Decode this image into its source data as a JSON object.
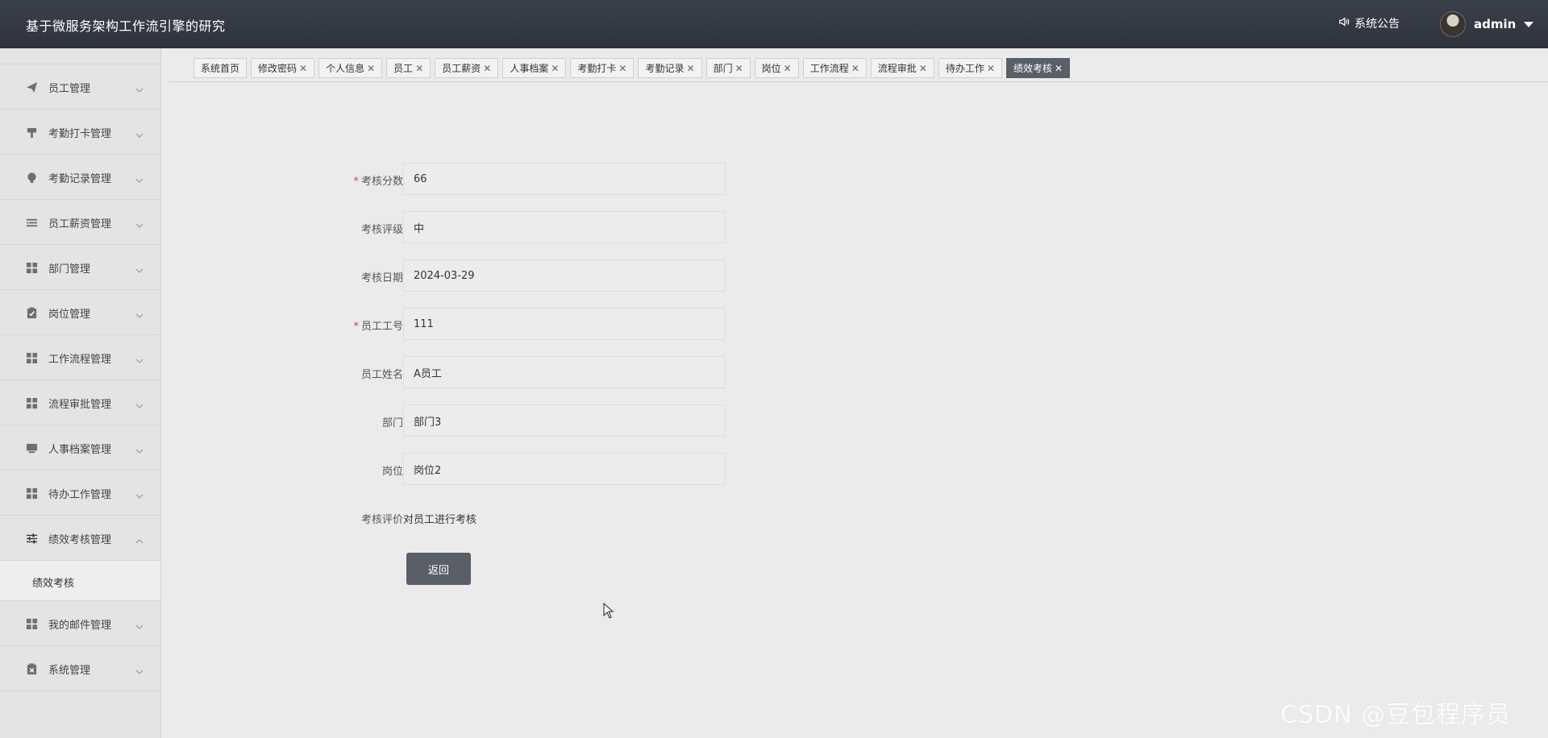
{
  "header": {
    "title": "基于微服务架构工作流引擎的研究",
    "notice_label": "系统公告",
    "username": "admin"
  },
  "sidebar": {
    "items": [
      {
        "label": "员工管理",
        "icon": "paper-plane-icon"
      },
      {
        "label": "考勤打卡管理",
        "icon": "brush-icon"
      },
      {
        "label": "考勤记录管理",
        "icon": "bulb-icon"
      },
      {
        "label": "员工薪资管理",
        "icon": "list-icon"
      },
      {
        "label": "部门管理",
        "icon": "grid-icon"
      },
      {
        "label": "岗位管理",
        "icon": "clipboard-check-icon"
      },
      {
        "label": "工作流程管理",
        "icon": "grid-icon"
      },
      {
        "label": "流程审批管理",
        "icon": "grid-icon"
      },
      {
        "label": "人事档案管理",
        "icon": "monitor-icon"
      },
      {
        "label": "待办工作管理",
        "icon": "grid-icon"
      },
      {
        "label": "绩效考核管理",
        "icon": "sliders-icon",
        "expanded": true
      },
      {
        "label": "我的邮件管理",
        "icon": "grid-icon"
      },
      {
        "label": "系统管理",
        "icon": "clipboard-x-icon"
      }
    ],
    "subitem": "绩效考核"
  },
  "tabs": [
    {
      "label": "系统首页",
      "closable": false
    },
    {
      "label": "修改密码",
      "closable": true
    },
    {
      "label": "个人信息",
      "closable": true
    },
    {
      "label": "员工",
      "closable": true
    },
    {
      "label": "员工薪资",
      "closable": true
    },
    {
      "label": "人事档案",
      "closable": true
    },
    {
      "label": "考勤打卡",
      "closable": true
    },
    {
      "label": "考勤记录",
      "closable": true
    },
    {
      "label": "部门",
      "closable": true
    },
    {
      "label": "岗位",
      "closable": true
    },
    {
      "label": "工作流程",
      "closable": true
    },
    {
      "label": "流程审批",
      "closable": true
    },
    {
      "label": "待办工作",
      "closable": true
    },
    {
      "label": "绩效考核",
      "closable": true,
      "active": true
    }
  ],
  "form": {
    "fields": [
      {
        "label": "考核分数",
        "required": true,
        "value": "66"
      },
      {
        "label": "考核评级",
        "required": false,
        "value": "中"
      },
      {
        "label": "考核日期",
        "required": false,
        "value": "2024-03-29"
      },
      {
        "label": "员工工号",
        "required": true,
        "value": "111"
      },
      {
        "label": "员工姓名",
        "required": false,
        "value": "A员工"
      },
      {
        "label": "部门",
        "required": false,
        "value": "部门3"
      },
      {
        "label": "岗位",
        "required": false,
        "value": "岗位2"
      }
    ],
    "evaluation_label": "考核评价",
    "evaluation_value": "对员工进行考核",
    "back_label": "返回"
  },
  "watermark": "CSDN @豆包程序员",
  "colors": {
    "topbar": "#2e333c",
    "accent": "#5a5e66",
    "required": "#e4393c"
  }
}
